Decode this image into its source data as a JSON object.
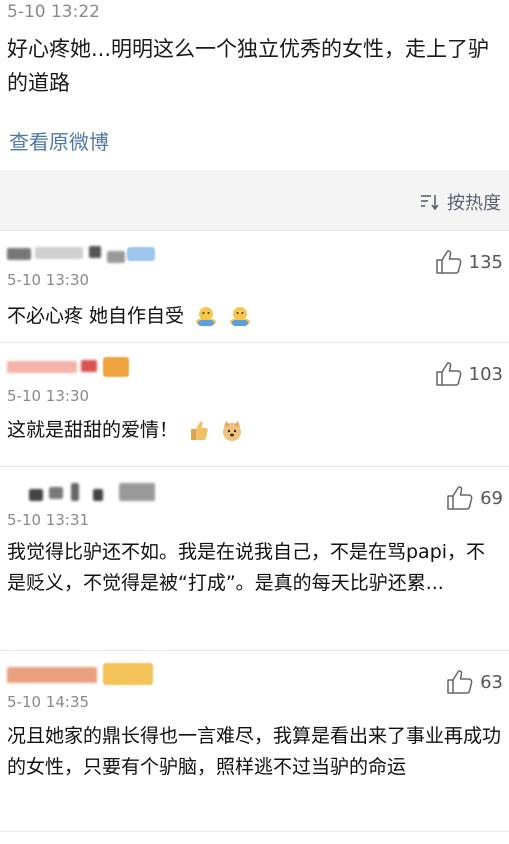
{
  "post": {
    "timestamp": "5-10 13:22",
    "text": "好心疼她...明明这么一个独立优秀的女性，走上了驴的道路",
    "view_original": "查看原微博"
  },
  "sort": {
    "label": "按热度",
    "icon": "sort-icon"
  },
  "comments": [
    {
      "timestamp": "5-10 13:30",
      "text": "不必心疼 她自作自受",
      "likes": "135",
      "emojis": [
        "hug-emoji",
        "hug-emoji"
      ]
    },
    {
      "timestamp": "5-10 13:30",
      "text": "这就是甜甜的爱情！",
      "likes": "103",
      "emojis": [
        "thumbs-up-emoji",
        "doge-emoji"
      ]
    },
    {
      "timestamp": "5-10 13:31",
      "text": "我觉得比驴还不如。我是在说我自己，不是在骂papi，不是贬义，不觉得是被“打成”。是真的每天比驴还累...",
      "likes": "69",
      "emojis": []
    },
    {
      "timestamp": "5-10 14:35",
      "text": "况且她家的鼎长得也一言难尽，我算是看出来了事业再成功的女性，只要有个驴脑，照样逃不过当驴的命运",
      "likes": "63",
      "emojis": []
    }
  ],
  "colors": {
    "link": "#4f7aa8",
    "timestamp": "#8a8a8a",
    "background": "#f4f4f4"
  }
}
